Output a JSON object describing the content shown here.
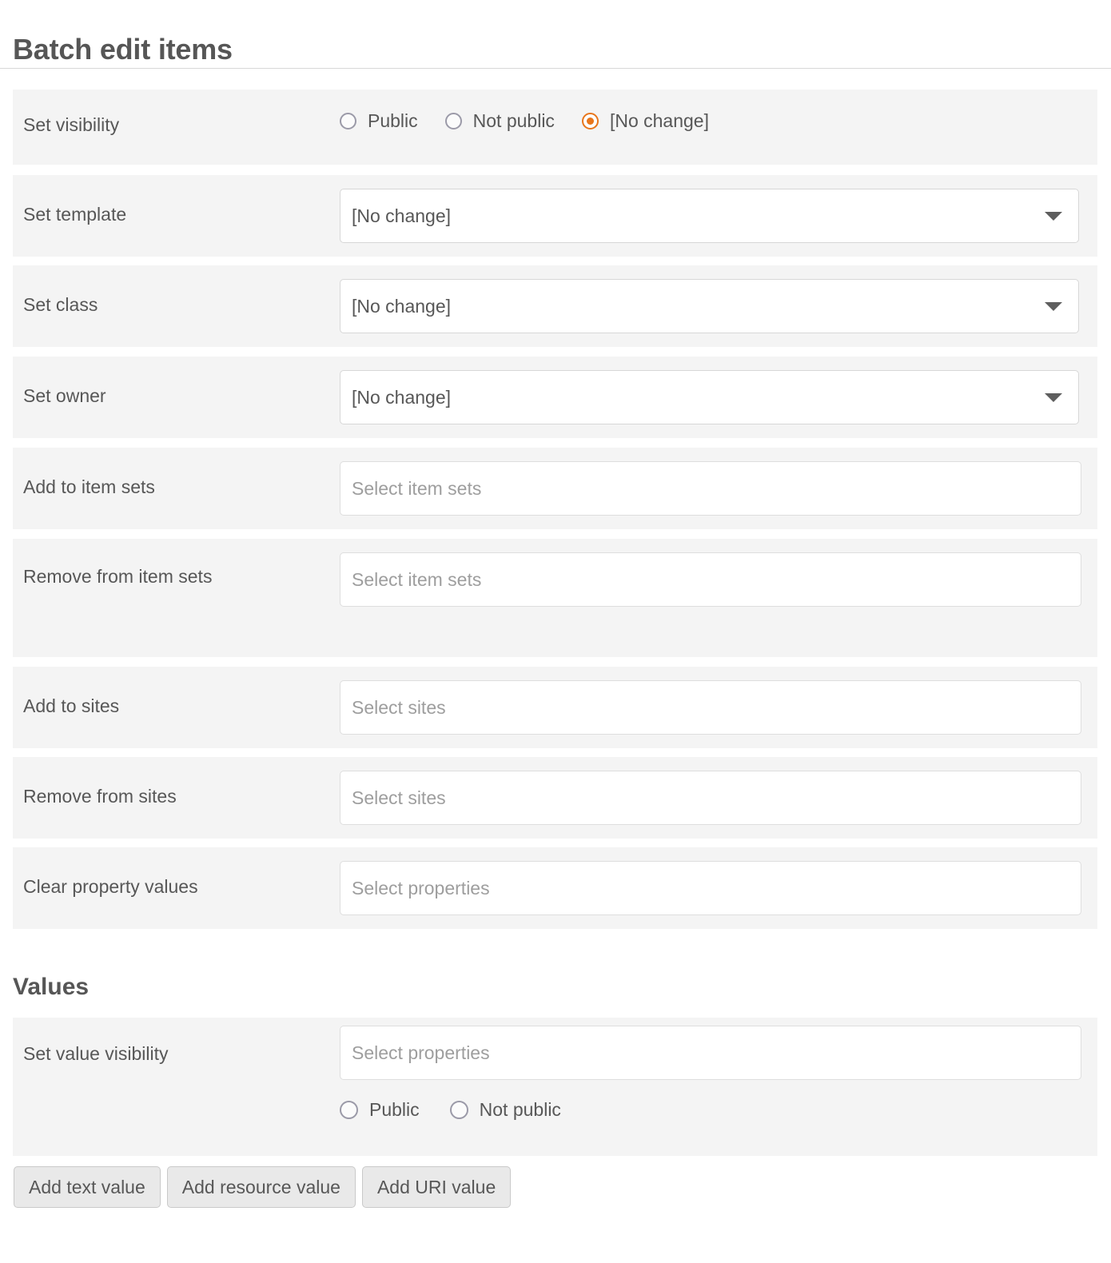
{
  "page": {
    "title": "Batch edit items"
  },
  "fields": {
    "set_visibility": {
      "label": "Set visibility",
      "options": [
        {
          "label": "Public",
          "checked": false
        },
        {
          "label": "Not public",
          "checked": false
        },
        {
          "label": "[No change]",
          "checked": true
        }
      ]
    },
    "set_template": {
      "label": "Set template",
      "value": "[No change]"
    },
    "set_class": {
      "label": "Set class",
      "value": "[No change]"
    },
    "set_owner": {
      "label": "Set owner",
      "value": "[No change]"
    },
    "add_to_item_sets": {
      "label": "Add to item sets",
      "value": "",
      "placeholder": "Select item sets"
    },
    "remove_from_item_sets": {
      "label": "Remove from item sets",
      "value": "",
      "placeholder": "Select item sets"
    },
    "add_to_sites": {
      "label": "Add to sites",
      "value": "",
      "placeholder": "Select sites"
    },
    "remove_from_sites": {
      "label": "Remove from sites",
      "value": "",
      "placeholder": "Select sites"
    },
    "clear_property_values": {
      "label": "Clear property values",
      "value": "",
      "placeholder": "Select properties"
    }
  },
  "values_section": {
    "heading": "Values",
    "set_value_visibility": {
      "label": "Set value visibility",
      "value": "",
      "placeholder": "Select properties",
      "options": [
        {
          "label": "Public",
          "checked": false
        },
        {
          "label": "Not public",
          "checked": false
        }
      ]
    },
    "buttons": [
      {
        "label": "Add text value"
      },
      {
        "label": "Add resource value"
      },
      {
        "label": "Add URI value"
      }
    ]
  },
  "icons": {
    "dropdown": "chevron-down-icon"
  },
  "colors": {
    "accent": "#e8761b",
    "row_background": "#f4f4f4",
    "text": "#575757",
    "border": "#d7d7d7",
    "button_background": "#e9e9e9"
  }
}
